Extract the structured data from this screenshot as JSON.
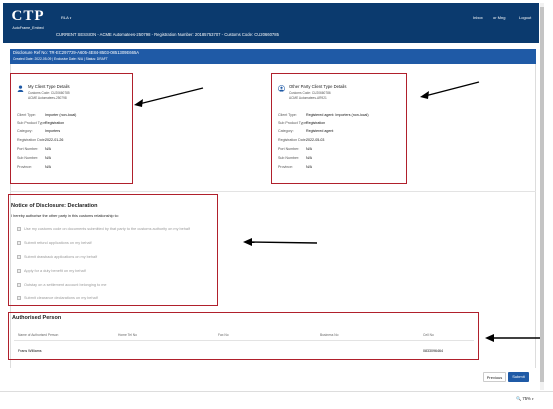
{
  "header": {
    "logo_main": "CTP",
    "logo_sub": "AutoFrame_Embed",
    "menu_label": "RLA",
    "nav_inbox": "Inbox",
    "nav_help": "or Mng",
    "nav_logout": "Logout",
    "session_line": "CURRENT SESSION - ACME Automatees-250798 - Registration Number: 20185753707 - Customs Code: CU20660785"
  },
  "disclosure": {
    "ref_line": "Disclosure Ref No: TR-EC297729-A605-4E84-8503-0851309E665A",
    "sub_line": "Created Date: 2022-05-09 | Exclusive Date: N/A | Status: DRAFT"
  },
  "client_card": {
    "title": "My Client Type Details",
    "code": "Customs Code: CU20660785",
    "auth": "ACME Automatees-250798",
    "rows": [
      {
        "k": "Client Type:",
        "v": "Importer (non-local)"
      },
      {
        "k": "Sub Product Type:",
        "v": "Registration"
      },
      {
        "k": "Category:",
        "v": "Importers"
      },
      {
        "k": "Registration Date:",
        "v": "2022-01-26"
      },
      {
        "k": "Port Number:",
        "v": "N/A"
      },
      {
        "k": "Sub Number:",
        "v": "N/A"
      },
      {
        "k": "Province:",
        "v": "N/A"
      }
    ]
  },
  "other_card": {
    "title": "Other Party Client Type Details",
    "code": "Customs Code: CU20660786",
    "auth": "ACME Automatees-AR921",
    "rows": [
      {
        "k": "Client Type:",
        "v": "Registered agent: Importers (non-local)"
      },
      {
        "k": "Sub Product Type:",
        "v": "Registration"
      },
      {
        "k": "Category:",
        "v": "Registered agent"
      },
      {
        "k": "Registration Date:",
        "v": "2022-05-03"
      },
      {
        "k": "Port Number:",
        "v": "N/A"
      },
      {
        "k": "Sub Number:",
        "v": "N/A"
      },
      {
        "k": "Province:",
        "v": "N/A"
      }
    ]
  },
  "declaration": {
    "title": "Notice of Disclosure: Declaration",
    "intro": "I hereby authorise the other party in this customs relationship to:",
    "options": [
      "Use my customs code on documents submitted by that party to the customs authority on my behalf",
      "Submit refund applications on my behalf",
      "Submit drawback applications on my behalf",
      "Apply for a duty benefit on my behalf",
      "Outstay on a settlement account belonging to me",
      "Submit clearance declarations on my behalf"
    ]
  },
  "authorised": {
    "title": "Authorised Person",
    "columns": [
      "Name of Authorised Person",
      "Home Tel No",
      "Fax No",
      "Business No",
      "Cell No"
    ],
    "row": [
      "Frans Williams",
      "",
      "",
      "",
      "0833096464"
    ]
  },
  "footer": {
    "previous_label": "Previous",
    "submit_label": "Submit",
    "zoom": "75%"
  },
  "colors": {
    "topbar": "#0b3a6e",
    "accent": "#1f5aa6",
    "highlight": "#b0202c"
  }
}
